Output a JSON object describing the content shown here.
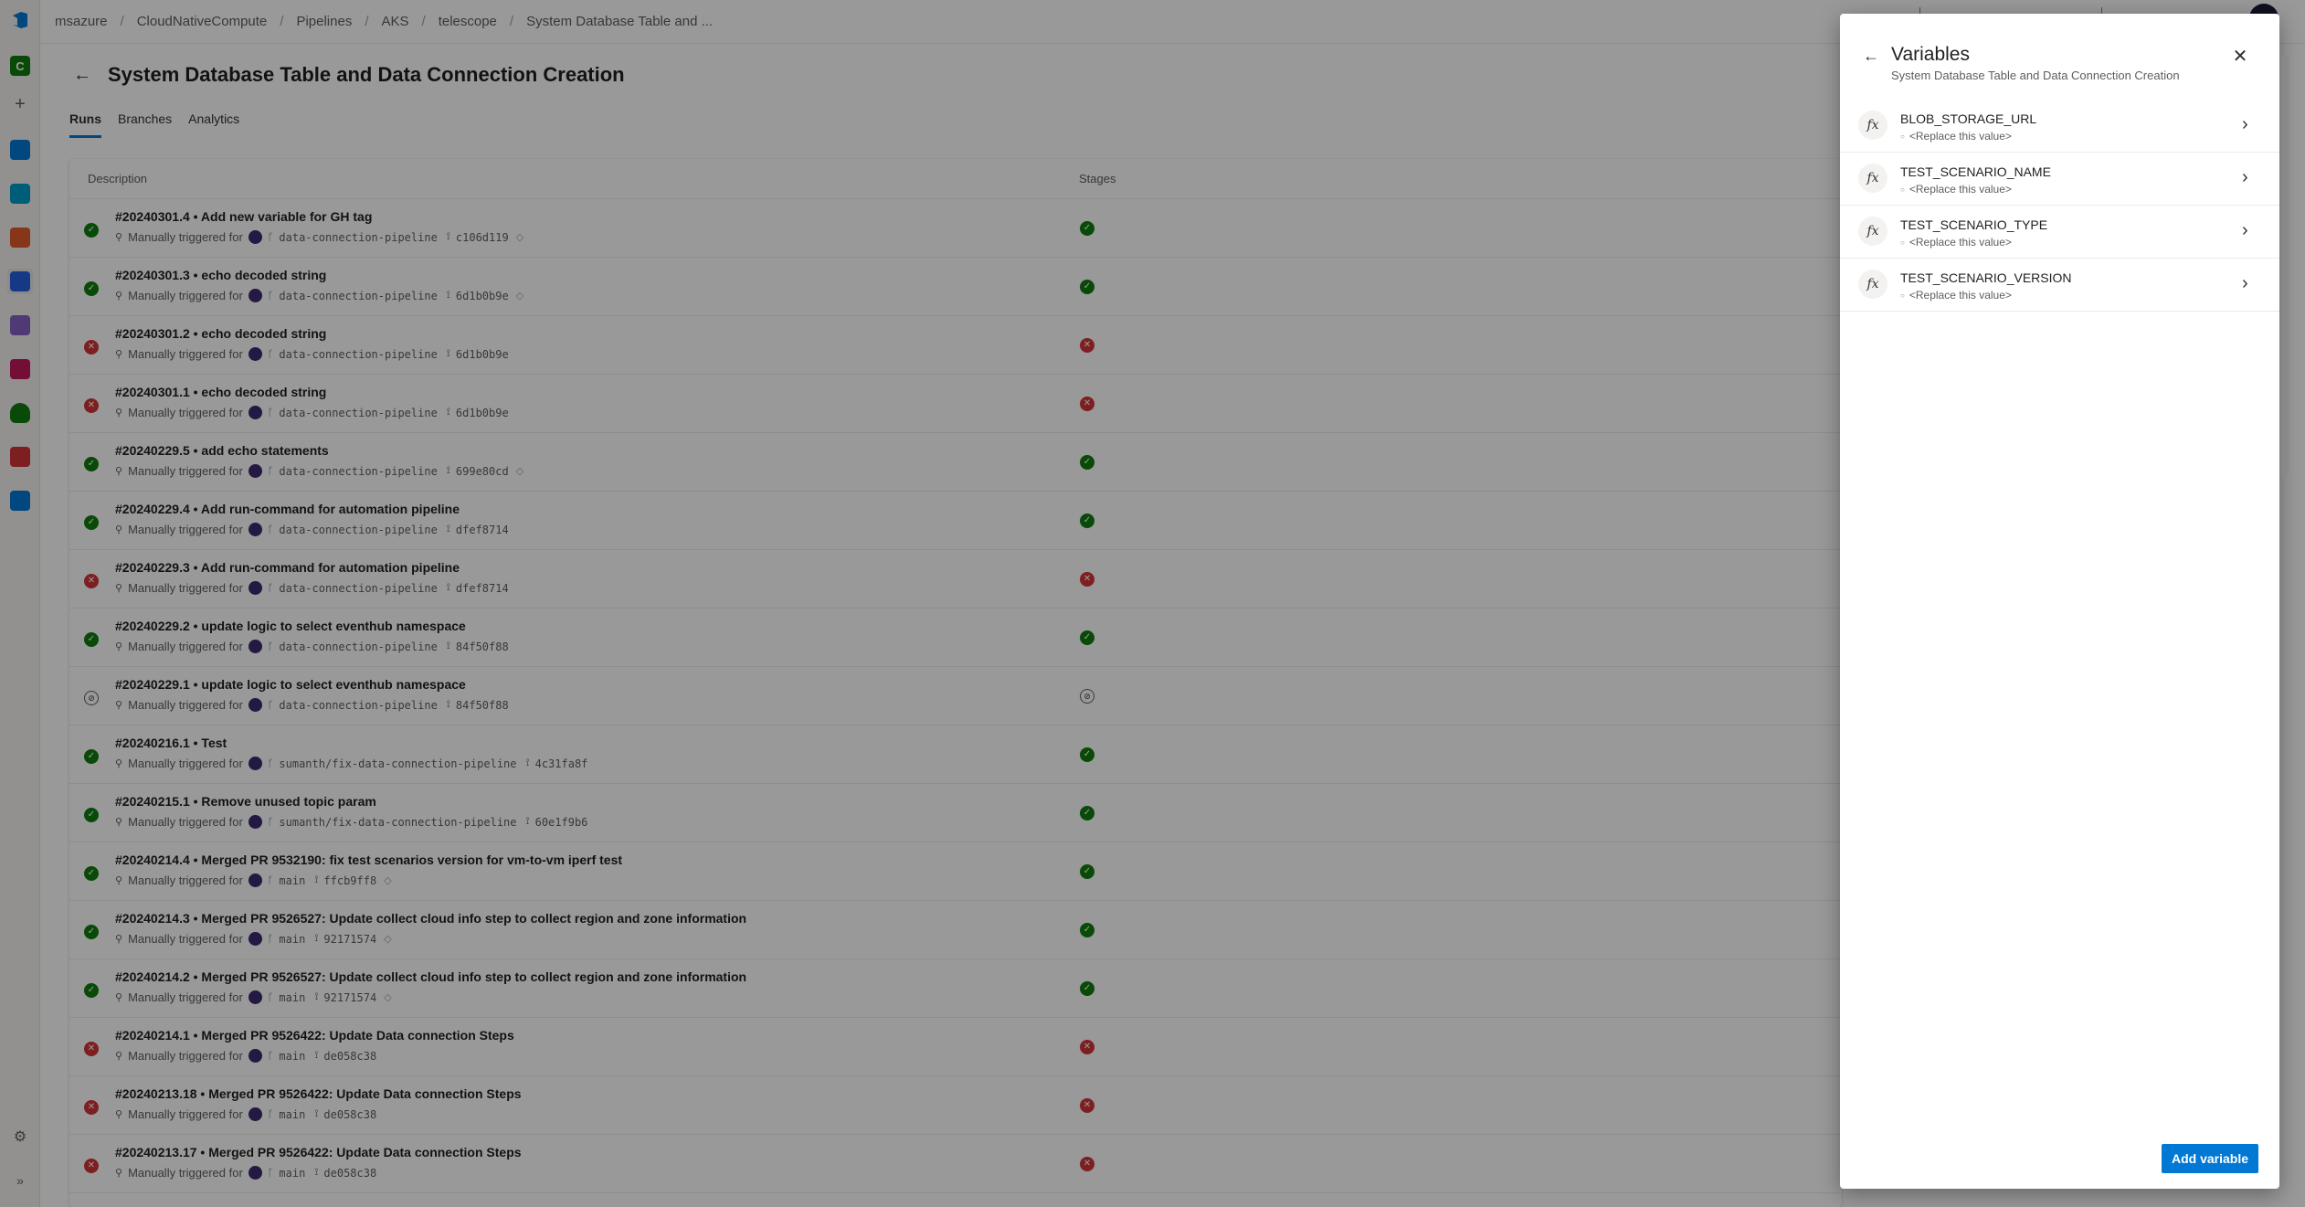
{
  "breadcrumb": [
    "msazure",
    "CloudNativeCompute",
    "Pipelines",
    "AKS",
    "telescope",
    "System Database Table and ..."
  ],
  "page": {
    "title": "System Database Table and Data Connection Creation",
    "tabs": [
      "Runs",
      "Branches",
      "Analytics"
    ]
  },
  "table": {
    "col_description": "Description",
    "col_stages": "Stages",
    "trigger_text": "Manually triggered for",
    "rows": [
      {
        "title": "#20240301.4 • Add new variable for GH tag",
        "branch": "data-connection-pipeline",
        "commit": "c106d119",
        "status": "succeeded",
        "tag": true
      },
      {
        "title": "#20240301.3 • echo decoded string",
        "branch": "data-connection-pipeline",
        "commit": "6d1b0b9e",
        "status": "succeeded",
        "tag": true
      },
      {
        "title": "#20240301.2 • echo decoded string",
        "branch": "data-connection-pipeline",
        "commit": "6d1b0b9e",
        "status": "failed",
        "tag": false
      },
      {
        "title": "#20240301.1 • echo decoded string",
        "branch": "data-connection-pipeline",
        "commit": "6d1b0b9e",
        "status": "failed",
        "tag": false
      },
      {
        "title": "#20240229.5 • add echo statements",
        "branch": "data-connection-pipeline",
        "commit": "699e80cd",
        "status": "succeeded",
        "tag": true
      },
      {
        "title": "#20240229.4 • Add run-command for automation pipeline",
        "branch": "data-connection-pipeline",
        "commit": "dfef8714",
        "status": "succeeded",
        "tag": false
      },
      {
        "title": "#20240229.3 • Add run-command for automation pipeline",
        "branch": "data-connection-pipeline",
        "commit": "dfef8714",
        "status": "failed",
        "tag": false
      },
      {
        "title": "#20240229.2 • update logic to select eventhub namespace",
        "branch": "data-connection-pipeline",
        "commit": "84f50f88",
        "status": "succeeded",
        "tag": false
      },
      {
        "title": "#20240229.1 • update logic to select eventhub namespace",
        "branch": "data-connection-pipeline",
        "commit": "84f50f88",
        "status": "canceled",
        "tag": false
      },
      {
        "title": "#20240216.1 • Test",
        "branch": "sumanth/fix-data-connection-pipeline",
        "commit": "4c31fa8f",
        "status": "succeeded",
        "tag": false
      },
      {
        "title": "#20240215.1 • Remove unused topic param",
        "branch": "sumanth/fix-data-connection-pipeline",
        "commit": "60e1f9b6",
        "status": "succeeded",
        "tag": false
      },
      {
        "title": "#20240214.4 • Merged PR 9532190: fix test scenarios version for vm-to-vm iperf test",
        "branch": "main",
        "commit": "ffcb9ff8",
        "status": "succeeded",
        "tag": true
      },
      {
        "title": "#20240214.3 • Merged PR 9526527: Update collect cloud info step to collect region and zone information",
        "branch": "main",
        "commit": "92171574",
        "status": "succeeded",
        "tag": true
      },
      {
        "title": "#20240214.2 • Merged PR 9526527: Update collect cloud info step to collect region and zone information",
        "branch": "main",
        "commit": "92171574",
        "status": "succeeded",
        "tag": true
      },
      {
        "title": "#20240214.1 • Merged PR 9526422: Update Data connection Steps",
        "branch": "main",
        "commit": "de058c38",
        "status": "failed",
        "tag": false
      },
      {
        "title": "#20240213.18 • Merged PR 9526422: Update Data connection Steps",
        "branch": "main",
        "commit": "de058c38",
        "status": "failed",
        "tag": false
      },
      {
        "title": "#20240213.17 • Merged PR 9526422: Update Data connection Steps",
        "branch": "main",
        "commit": "de058c38",
        "status": "failed",
        "tag": false
      }
    ]
  },
  "panel": {
    "title": "Variables",
    "subtitle": "System Database Table and Data Connection Creation",
    "variables": [
      {
        "name": "BLOB_STORAGE_URL",
        "value": "<Replace this value>"
      },
      {
        "name": "TEST_SCENARIO_NAME",
        "value": "<Replace this value>"
      },
      {
        "name": "TEST_SCENARIO_TYPE",
        "value": "<Replace this value>"
      },
      {
        "name": "TEST_SCENARIO_VERSION",
        "value": "<Replace this value>"
      }
    ],
    "add_button": "Add variable"
  },
  "rail": {
    "org_initial": "C"
  },
  "colors": {
    "accent": "#0078d4",
    "succeeded": "#107c10",
    "failed": "#d13438"
  }
}
